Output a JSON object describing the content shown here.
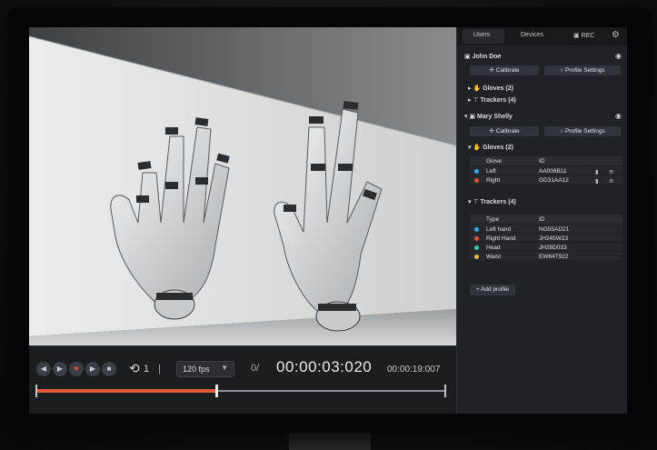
{
  "tabs": [
    {
      "label": "Users",
      "selected": true
    },
    {
      "label": "Devices",
      "selected": false
    },
    {
      "label": "REC",
      "selected": false
    }
  ],
  "users": [
    {
      "name": "John Doe",
      "calibrate_label": "Calibrate",
      "profile_label": "Profile Settings",
      "gloves_label": "Gloves (2)",
      "trackers_label": "Trackers (4)"
    },
    {
      "name": "Mary Shelly",
      "calibrate_label": "Calibrate",
      "profile_label": "Profile Settings",
      "gloves_label": "Gloves (2)",
      "gloves_table": {
        "headers": [
          "Glove",
          "ID"
        ],
        "rows": [
          {
            "name": "Left",
            "id": "AA008B11",
            "color": "#3aa7e0"
          },
          {
            "name": "Right",
            "id": "GD31AA12",
            "color": "#e0533a"
          }
        ]
      },
      "trackers_label": "Trackers (4)",
      "trackers_table": {
        "headers": [
          "Type",
          "ID"
        ],
        "rows": [
          {
            "name": "Left hand",
            "id": "NG55AD21",
            "color": "#3aa7e0"
          },
          {
            "name": "Right Hand",
            "id": "JH245W23",
            "color": "#e0533a"
          },
          {
            "name": "Head",
            "id": "JH28D033",
            "color": "#3ec9a0"
          },
          {
            "name": "Waist",
            "id": "EW64T922",
            "color": "#e0b83a"
          }
        ]
      }
    }
  ],
  "add_profile_label": "+ Add profile",
  "playback": {
    "loop_count": "1",
    "fps": "120 fps",
    "timecode": "00:00:03:020",
    "duration": "00:00:19:007",
    "progress": 0.44
  },
  "colors": {
    "accent": "#e35a3a",
    "panel": "#1f2226"
  }
}
